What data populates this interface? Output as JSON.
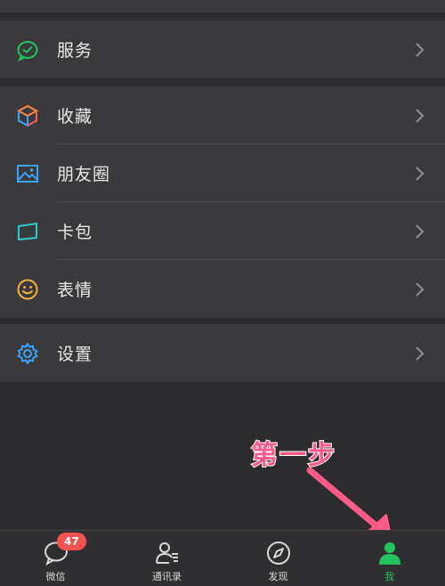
{
  "groups": [
    {
      "items": [
        {
          "label": "服务",
          "icon": "service-icon"
        }
      ]
    },
    {
      "items": [
        {
          "label": "收藏",
          "icon": "favorites-cube-icon"
        },
        {
          "label": "朋友圈",
          "icon": "moments-image-icon"
        },
        {
          "label": "卡包",
          "icon": "card-wallet-icon"
        },
        {
          "label": "表情",
          "icon": "sticker-smile-icon"
        }
      ]
    },
    {
      "items": [
        {
          "label": "设置",
          "icon": "settings-gear-icon"
        }
      ]
    }
  ],
  "annotation": {
    "text": "第一步"
  },
  "tabbar": {
    "tabs": [
      {
        "label": "微信",
        "icon": "chat-bubble-icon",
        "badge": "47"
      },
      {
        "label": "通讯录",
        "icon": "contacts-icon"
      },
      {
        "label": "发现",
        "icon": "compass-icon"
      },
      {
        "label": "我",
        "icon": "person-icon",
        "active": true
      }
    ]
  },
  "colors": {
    "accent": "#22c35e",
    "badge": "#fa5151",
    "annotation": "#ff5a8a",
    "background": "#2c2c2e",
    "row": "#3a3a3c"
  }
}
